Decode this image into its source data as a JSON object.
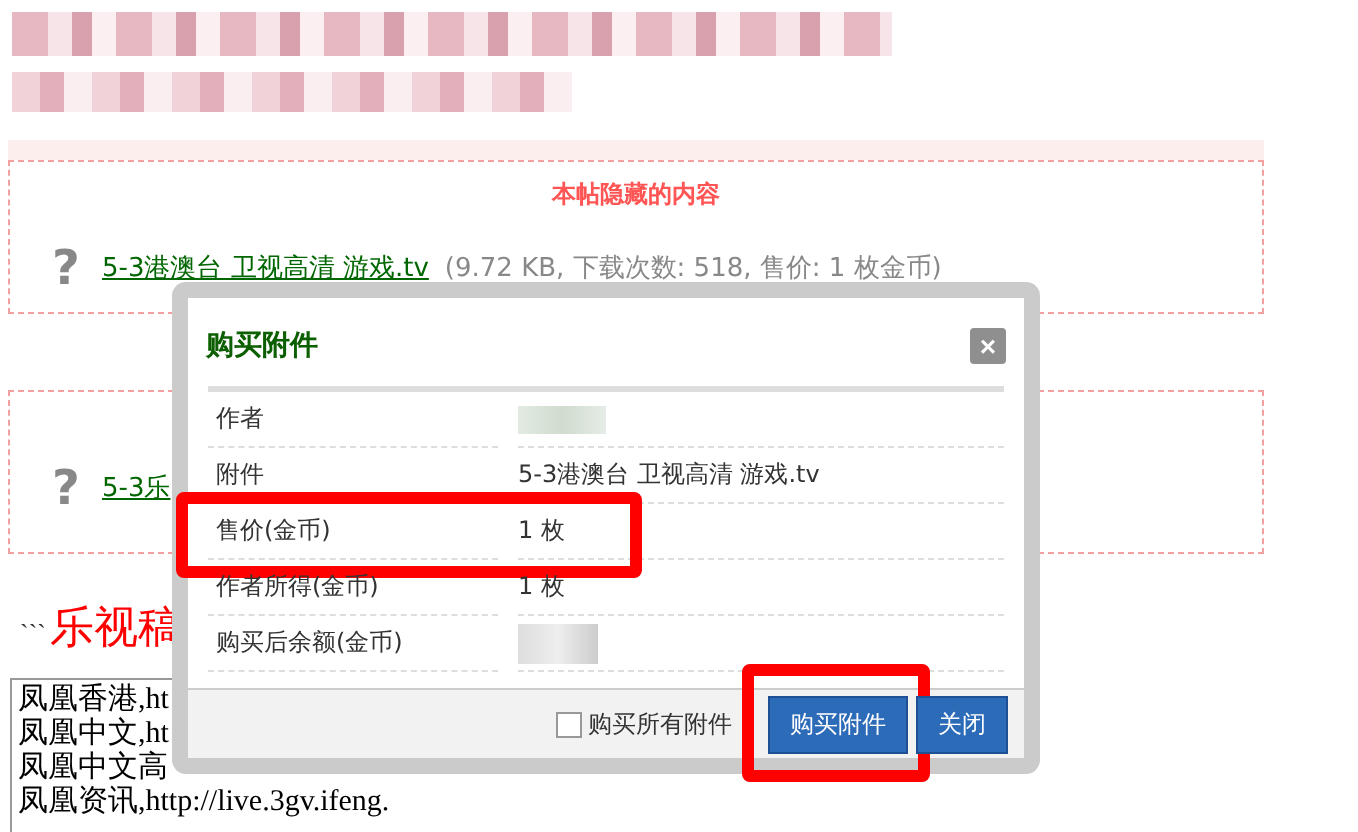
{
  "hidden_section": {
    "title": "本帖隐藏的内容",
    "attachment": {
      "icon": "?",
      "link": "5-3港澳台 卫视高清 游戏.tv",
      "meta": "(9.72 KB, 下载次数: 518, 售价: 1 枚金币)"
    }
  },
  "second_attachment": {
    "icon": "?",
    "link": "5-3乐"
  },
  "heading": {
    "prefix": "```",
    "text": "乐视稿"
  },
  "code_lines": [
    "凤凰香港,ht",
    "凤凰中文,ht",
    "凤凰中文高",
    "凤凰资讯,http://live.3gv.ifeng."
  ],
  "dialog": {
    "title": "购买附件",
    "close": "×",
    "rows": [
      {
        "label": "作者",
        "value": null,
        "highlighted": false
      },
      {
        "label": "附件",
        "value": "5-3港澳台 卫视高清 游戏.tv",
        "highlighted": false
      },
      {
        "label": "售价(金币)",
        "value": "1 枚",
        "highlighted": true
      },
      {
        "label": "作者所得(金币)",
        "value": "1 枚",
        "highlighted": false
      },
      {
        "label": "购买后余额(金币)",
        "value": null,
        "highlighted": false
      }
    ],
    "buy_all": {
      "label": "购买所有附件",
      "checked": false
    },
    "buttons": [
      {
        "label": "购买附件",
        "highlighted": true
      },
      {
        "label": "关闭",
        "highlighted": false
      }
    ]
  }
}
